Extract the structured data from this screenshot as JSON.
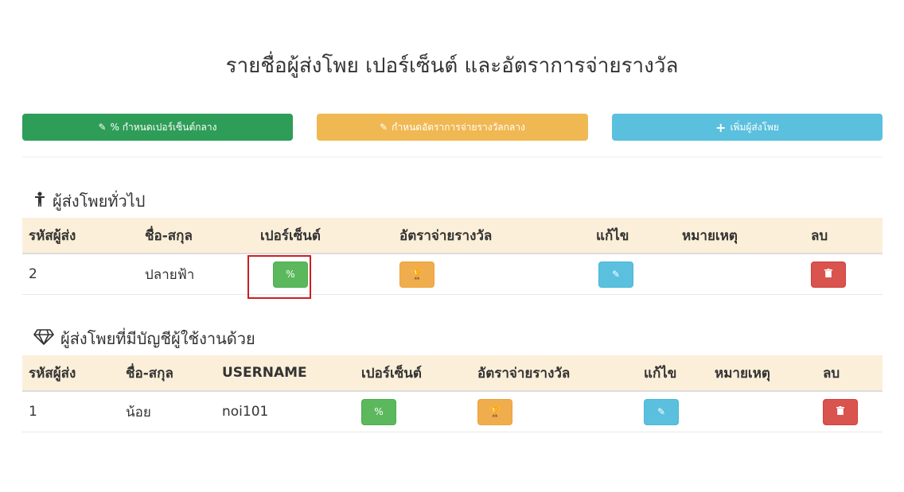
{
  "page": {
    "title": "รายชื่อผู้ส่งโพย เปอร์เซ็นต์ และอัตราการจ่ายรางวัล"
  },
  "toolbar": {
    "set_percent_label": "% กำหนดเปอร์เซ็นต์กลาง",
    "set_payout_label": "กำหนดอัตราการจ่ายรางวัลกลาง",
    "add_sender_label": "เพิ่มผู้ส่งโพย"
  },
  "general": {
    "section_title": "ผู้ส่งโพยทั่วไป",
    "headers": [
      "รหัสผู้ส่ง",
      "ชื่อ-สกุล",
      "เปอร์เซ็นต์",
      "อัตราจ่ายรางวัล",
      "แก้ไข",
      "หมายเหตุ",
      "ลบ"
    ],
    "rows": [
      {
        "id": "2",
        "name": "ปลายฟ้า",
        "percent_btn": "%",
        "note": ""
      }
    ]
  },
  "accounts": {
    "section_title": "ผู้ส่งโพยที่มีบัญชีผู้ใช้งานด้วย",
    "headers": [
      "รหัสผู้ส่ง",
      "ชื่อ-สกุล",
      "USERNAME",
      "เปอร์เซ็นต์",
      "อัตราจ่ายรางวัล",
      "แก้ไข",
      "หมายเหตุ",
      "ลบ"
    ],
    "rows": [
      {
        "id": "1",
        "name": "น้อย",
        "username": "noi101",
        "percent_btn": "%",
        "note": ""
      }
    ]
  },
  "colors": {
    "green": "#2e9d57",
    "yellow": "#f0b853",
    "blue": "#5bc0de",
    "red": "#d9534f",
    "header_bg": "#fcefd9",
    "highlight": "#cc1f1f"
  }
}
